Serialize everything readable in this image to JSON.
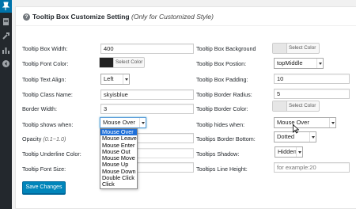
{
  "panel": {
    "title": "Tooltip Box Customize Setting",
    "title_note": "(Only for Customized Style)"
  },
  "left": {
    "box_width": {
      "label": "Tooltip Box Width:",
      "value": "400"
    },
    "font_color": {
      "label": "Tooltip Font Color:",
      "button": "Select Color",
      "swatch": "#222222"
    },
    "text_align": {
      "label": "Tooltip Text Align:",
      "value": "Left"
    },
    "class_name": {
      "label": "Tooltip Class Name:",
      "value": "skyisblue"
    },
    "border_width": {
      "label": "Border Width:",
      "value": "3"
    },
    "shows_when": {
      "label": "Tooltip shows when:",
      "value": "Mouse Over"
    },
    "opacity": {
      "label": "Opacity",
      "hint": "(0.1~1.0)"
    },
    "underline_color": {
      "label": "Tooltip Underline Color:"
    },
    "font_size": {
      "label": "Tooltip Font Size:"
    }
  },
  "right": {
    "box_background": {
      "label": "Tooltip Box Background",
      "button": "Select Color",
      "swatch": "#e6e6e6"
    },
    "box_position": {
      "label": "Tooltip Box Postion:",
      "value": "topMiddle"
    },
    "box_padding": {
      "label": "Tooltip Box Padding:",
      "value": "10"
    },
    "border_radius": {
      "label": "Tooltip Border Radius:",
      "value": "5"
    },
    "border_color": {
      "label": "Tooltip Border Color:",
      "button": "Select Color",
      "swatch": "#e6e6e6"
    },
    "hides_when": {
      "label": "Tooltip hides when:",
      "value": "Mouse Over"
    },
    "border_bottom": {
      "label": "Tooltips Border Bottom:",
      "value": "Dotted"
    },
    "shadow": {
      "label": "Tooltips Shadow:",
      "value": "Hidden"
    },
    "line_height": {
      "label": "Tooltips Line Height:",
      "placeholder": "for example:20"
    }
  },
  "dropdown": {
    "options": [
      "Mouse Over",
      "Mouse Leave",
      "Mouse Enter",
      "Mouse Out",
      "Mouse Move",
      "Mouse Up",
      "Mouse Down",
      "Double Click",
      "Click"
    ],
    "selected_index": 0
  },
  "save_button": "Save Changes",
  "colors": {
    "accent": "#0085ba",
    "sidebar": "#23282d",
    "sidebar_active": "#0073aa",
    "highlight": "#1e6fd9"
  }
}
